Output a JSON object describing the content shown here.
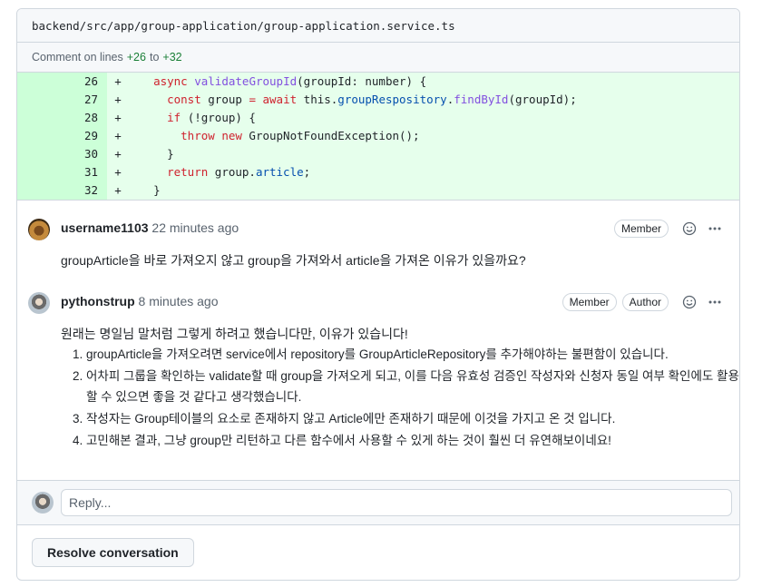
{
  "file": {
    "path": "backend/src/app/group-application/group-application.service.ts"
  },
  "range": {
    "prefix": "Comment on lines",
    "from": "+26",
    "sep": "to",
    "to": "+32"
  },
  "diff": {
    "lines": [
      {
        "num": "26",
        "sign": "+"
      },
      {
        "num": "27",
        "sign": "+"
      },
      {
        "num": "28",
        "sign": "+"
      },
      {
        "num": "29",
        "sign": "+"
      },
      {
        "num": "30",
        "sign": "+"
      },
      {
        "num": "31",
        "sign": "+"
      },
      {
        "num": "32",
        "sign": "+"
      }
    ],
    "tokens": {
      "l26": [
        "async",
        " ",
        "validateGroupId",
        "(groupId: number) {"
      ],
      "l27": [
        "const",
        " group ",
        "=",
        " ",
        "await",
        " this.",
        "groupRespository",
        ".",
        "findById",
        "(groupId);"
      ],
      "l28": [
        "if",
        " (!group) {"
      ],
      "l29": [
        "throw",
        " ",
        "new",
        " GroupNotFoundException();"
      ],
      "l30": [
        "}"
      ],
      "l31": [
        "return",
        " group.",
        "article",
        ";"
      ],
      "l32": [
        "}"
      ]
    }
  },
  "comments": [
    {
      "user": "username1103",
      "time": "22 minutes ago",
      "badges": [
        "Member"
      ],
      "body": "groupArticle을 바로 가져오지 않고 group을 가져와서 article을 가져온 이유가 있을까요?"
    },
    {
      "user": "pythonstrup",
      "time": "8 minutes ago",
      "badges": [
        "Member",
        "Author"
      ],
      "intro": "원래는 명일님 말처럼 그렇게 하려고 했습니다만, 이유가 있습니다!",
      "list": [
        "groupArticle을 가져오려면 service에서 repository를 GroupArticleRepository를 추가해야하는 불편함이 있습니다.",
        "어차피 그룹을 확인하는 validate할 때 group을 가져오게 되고, 이를 다음 유효성 검증인 작성자와 신청자 동일 여부 확인에도 활용할 수 있으면 좋을 것 같다고 생각했습니다.",
        "작성자는 Group테이블의 요소로 존재하지 않고 Article에만 존재하기 때문에 이것을 가지고 온 것 입니다.",
        "고민해본 결과, 그냥 group만 리턴하고 다른 함수에서 사용할 수 있게 하는 것이 훨씬 더 유연해보이네요!"
      ]
    }
  ],
  "reply": {
    "placeholder": "Reply..."
  },
  "actions": {
    "resolve": "Resolve conversation"
  },
  "icons": {
    "emoji": "smiley-icon",
    "more": "kebab-horizontal-icon"
  },
  "colors": {
    "added_bg": "#e6ffec",
    "added_gutter": "#ccffd8",
    "keyword": "#cf222e",
    "function": "#8250df",
    "constant": "#0550ae"
  }
}
